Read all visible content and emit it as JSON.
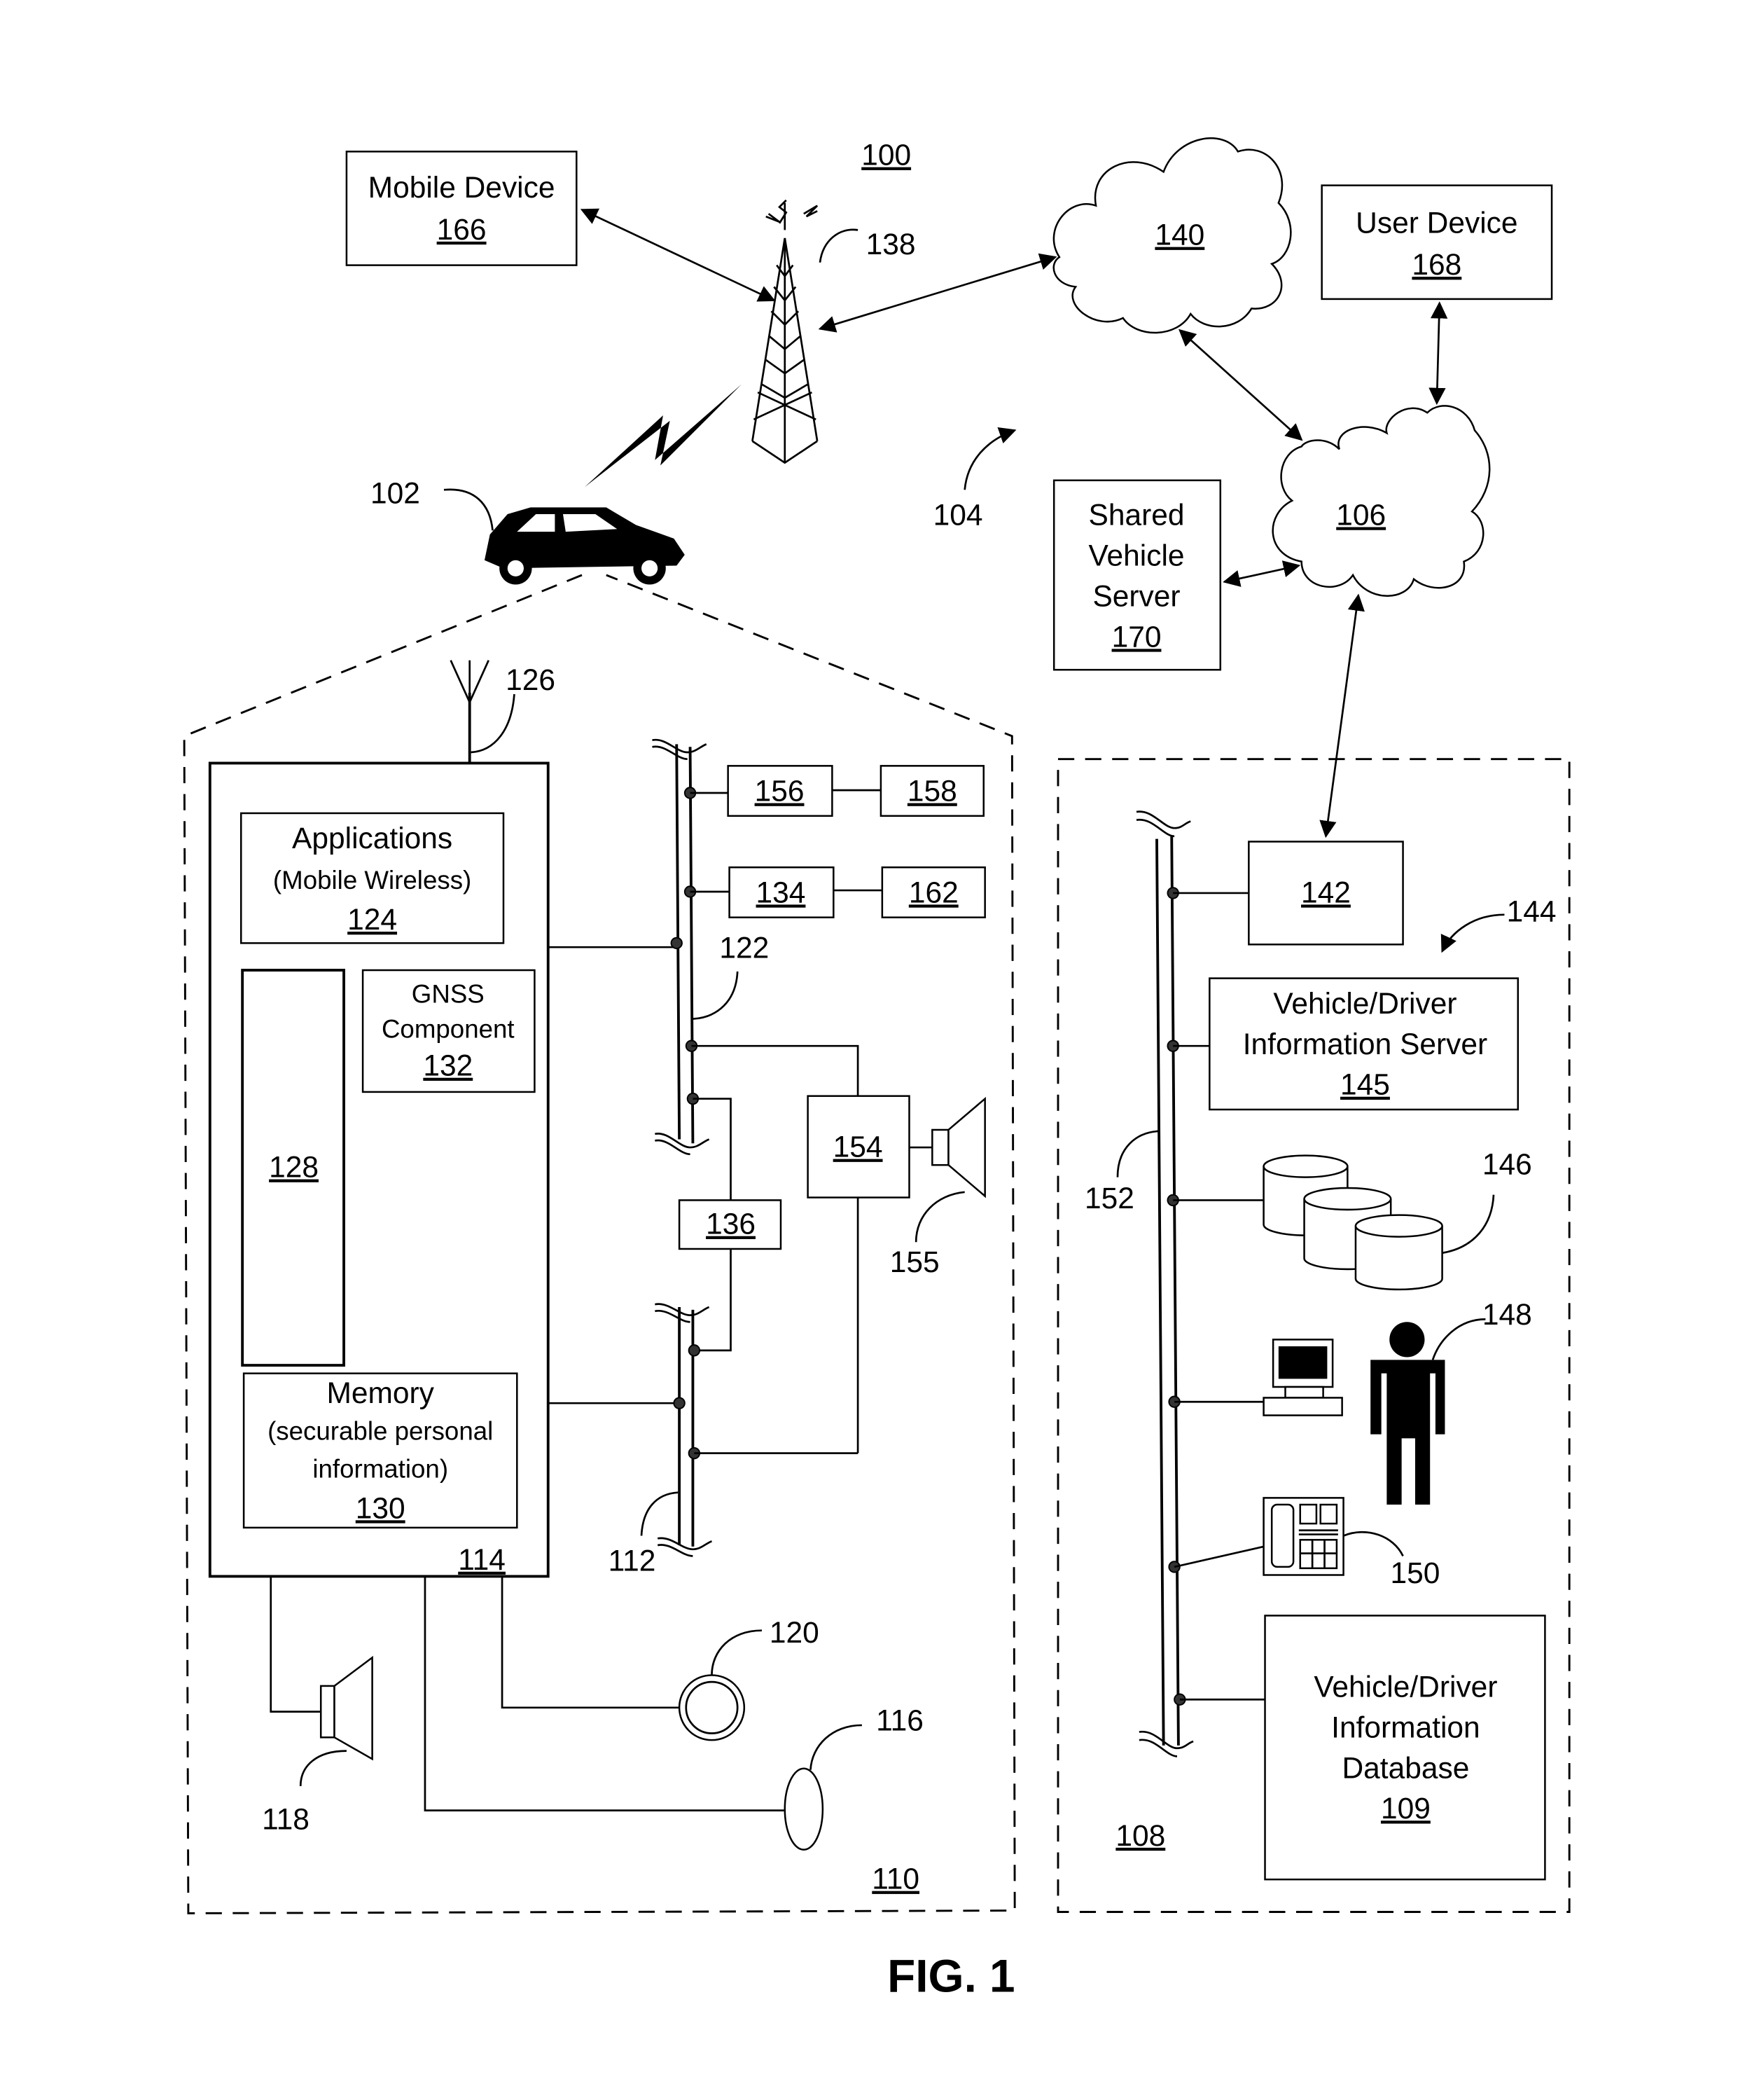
{
  "figure": {
    "title": "FIG. 1",
    "system_ref": "100",
    "network_ref": "104"
  },
  "external": {
    "mobile_device": {
      "label": "Mobile Device",
      "ref": "166"
    },
    "user_device": {
      "label": "User Device",
      "ref": "168"
    },
    "shared_vehicle_server": {
      "lines": [
        "Shared",
        "Vehicle",
        "Server"
      ],
      "ref": "170"
    },
    "tower_ref": "138",
    "cloud_140_ref": "140",
    "cloud_106_ref": "106",
    "vehicle_ref": "102"
  },
  "vehicle_system": {
    "region_ref": "110",
    "unit_ref": "114",
    "antenna_ref": "126",
    "applications": {
      "title": "Applications",
      "subtitle": "(Mobile Wireless)",
      "ref": "124"
    },
    "gnss": {
      "lines": [
        "GNSS",
        "Component"
      ],
      "ref": "132"
    },
    "processor_ref": "128",
    "memory": {
      "title": "Memory",
      "lines": [
        "(securable personal",
        "information)"
      ],
      "ref": "130"
    },
    "bus_upper_ref": "122",
    "bus_lower_ref": "112",
    "modules": [
      "156",
      "158",
      "134",
      "162",
      "154",
      "136"
    ],
    "speaker_155_ref": "155",
    "speaker_118_ref": "118",
    "button_120_ref": "120",
    "microphone_116_ref": "116"
  },
  "backend": {
    "region_ref": "108",
    "bus_ref": "152",
    "node_142_ref": "142",
    "server_group_ref": "144",
    "info_server": {
      "lines": [
        "Vehicle/Driver",
        "Information Server"
      ],
      "ref": "145"
    },
    "databases_ref": "146",
    "operator_ref": "148",
    "phone_ref": "150",
    "info_database": {
      "lines": [
        "Vehicle/Driver",
        "Information",
        "Database"
      ],
      "ref": "109"
    }
  }
}
